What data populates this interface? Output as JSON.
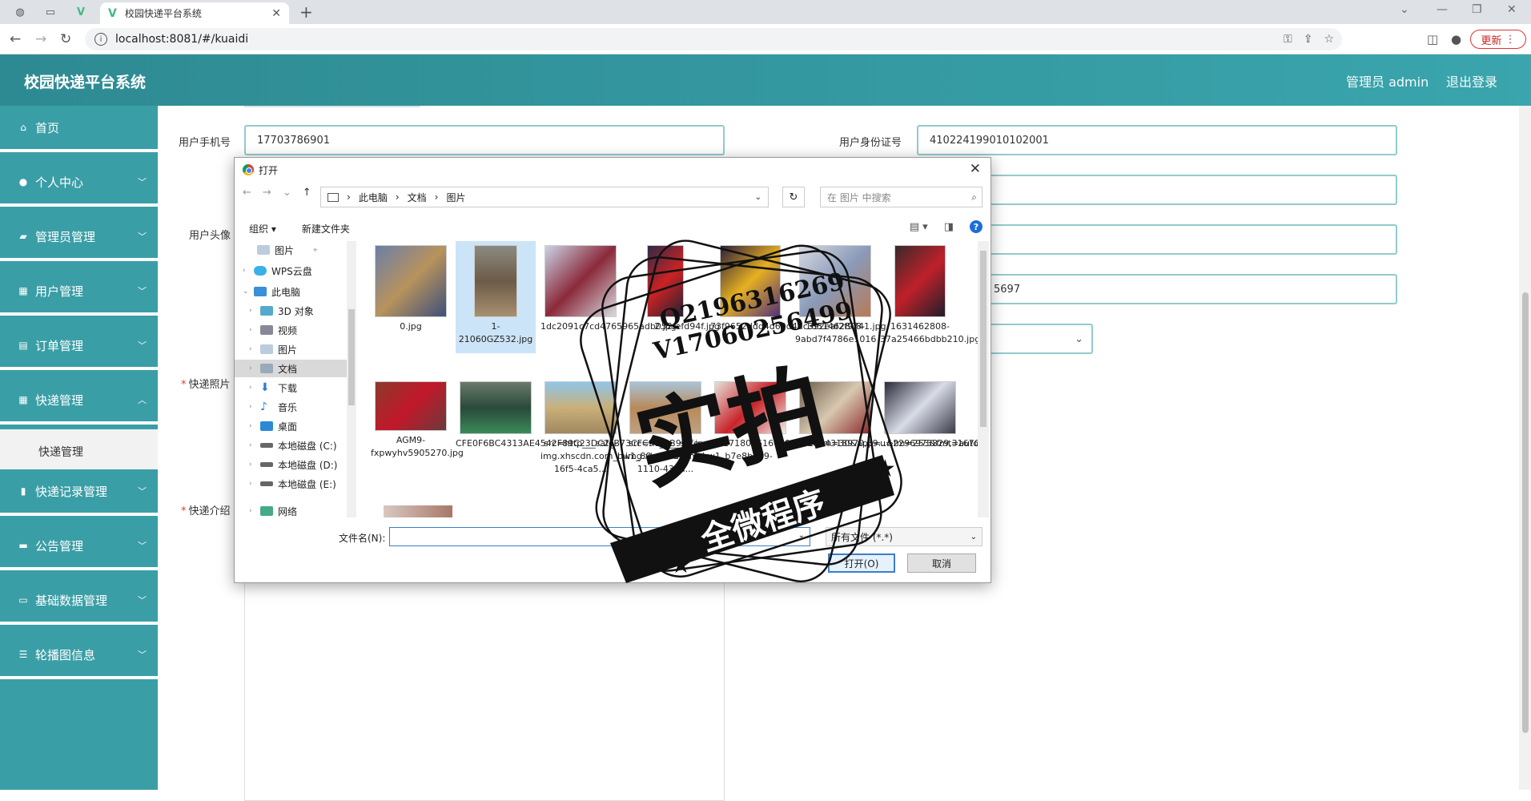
{
  "browser": {
    "tab_title": "校园快递平台系统",
    "url": "localhost:8081/#/kuaidi",
    "update_label": "更新"
  },
  "header": {
    "title": "校园快递平台系统",
    "admin": "管理员 admin",
    "logout": "退出登录"
  },
  "sidebar": {
    "items": [
      {
        "label": "首页"
      },
      {
        "label": "个人中心"
      },
      {
        "label": "管理员管理"
      },
      {
        "label": "用户管理"
      },
      {
        "label": "订单管理"
      },
      {
        "label": "快递管理"
      },
      {
        "label": "快递记录管理"
      },
      {
        "label": "公告管理"
      },
      {
        "label": "基础数据管理"
      },
      {
        "label": "轮播图信息"
      }
    ],
    "sub_item": "快递管理"
  },
  "form": {
    "phone_label": "用户手机号",
    "phone_value": "17703786901",
    "idcard_label": "用户身份证号",
    "idcard_value": "410224199010102001",
    "avatar_label": "用户头像",
    "photo_label": "快递照片",
    "intro_label": "快递介绍",
    "partial_value": "5697"
  },
  "dialog": {
    "title": "打开",
    "path": [
      "此电脑",
      "文档",
      "图片"
    ],
    "search_placeholder": "在 图片 中搜索",
    "organize": "组织 ▾",
    "new_folder": "新建文件夹",
    "tree": [
      {
        "label": "图片"
      },
      {
        "label": "WPS云盘"
      },
      {
        "label": "此电脑"
      },
      {
        "label": "3D 对象"
      },
      {
        "label": "视频"
      },
      {
        "label": "图片"
      },
      {
        "label": "文档"
      },
      {
        "label": "下载"
      },
      {
        "label": "音乐"
      },
      {
        "label": "桌面"
      },
      {
        "label": "本地磁盘 (C:)"
      },
      {
        "label": "本地磁盘 (D:)"
      },
      {
        "label": "本地磁盘 (E:)"
      },
      {
        "label": "网络"
      }
    ],
    "files": [
      {
        "name": "0.jpg"
      },
      {
        "name": "1-21060GZ532.jpg"
      },
      {
        "name": "1dc2091c7cd4765965adb052fefd94f.jpg"
      },
      {
        "name": "2.jpg"
      },
      {
        "name": "73f9652ddd4d60d4dc392eaf2f9741.jpg"
      },
      {
        "name": "1631462808-9abd7f4786e1016"
      },
      {
        "name": "1631462808-37a25466bdbb210.jpg"
      },
      {
        "name": "AGM9-fxpwyhv5905270.jpg"
      },
      {
        "name": "CFE0F6BC4313AE4542F89C23DC2_B73CFC94_2B979.jpg"
      },
      {
        "name": "src=http___safe-img.xhscdn.com_bw1_80aa2132-16f5-4ca5..."
      },
      {
        "name": "src=http___safe-img.xhscdn.com_bw1_b7e8bad9-1110-436a..."
      },
      {
        "name": "u=1718065160690659&fm=30&app=..."
      },
      {
        "name": "u=2024318970,59...&fm=253&fmt=auto"
      },
      {
        "name": "u=2296973829,3167080028&fm=253&fmt=auto&app=138..."
      }
    ],
    "filename_label": "文件名(N):",
    "filename_value": "",
    "filetype": "所有文件 (*.*)",
    "open_label": "打开(O)",
    "cancel_label": "取消"
  },
  "watermark": {
    "line1": "Q2196316269",
    "line2": "V17060256499",
    "big": "实拍",
    "banner": "全微程序"
  },
  "colors": {
    "header": "#3aa5ad",
    "sidebar": "#3a9ea6",
    "input_border": "#92cbcd"
  }
}
